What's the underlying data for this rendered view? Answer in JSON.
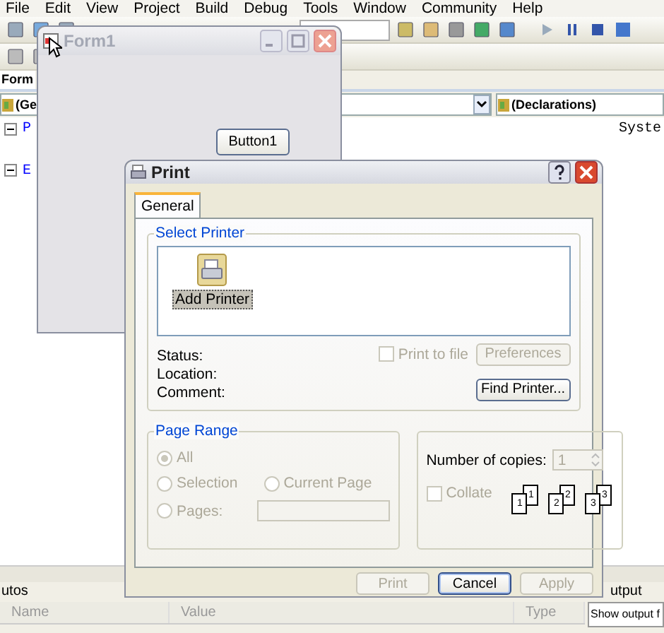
{
  "menu": [
    "File",
    "Edit",
    "View",
    "Project",
    "Build",
    "Debug",
    "Tools",
    "Window",
    "Community",
    "Help"
  ],
  "editor": {
    "tab": "Form",
    "left_dropdown": "(Ge",
    "right_dropdown": "(Declarations)",
    "code": [
      {
        "text": "P",
        "kind": "keyword"
      },
      {
        "text": "E",
        "kind": "keyword"
      },
      {
        "text": "Syste",
        "kind": "plain"
      }
    ]
  },
  "autos_panel": {
    "title": "utos",
    "columns": [
      "Name",
      "Value",
      "Type"
    ]
  },
  "output_panel": {
    "title": "utput",
    "dropdown": "Show output f"
  },
  "form_window": {
    "title": "Form1",
    "button": "Button1"
  },
  "print_dialog": {
    "title": "Print",
    "tabs": [
      {
        "label": "General",
        "selected": true
      }
    ],
    "select_printer": {
      "title": "Select Printer",
      "printers": [
        {
          "label": "Add Printer",
          "selected": true
        }
      ]
    },
    "info_labels": [
      "Status:",
      "Location:",
      "Comment:"
    ],
    "print_to_file": {
      "label": "Print to file",
      "checked": false,
      "disabled": true
    },
    "side_buttons": [
      {
        "label": "Preferences",
        "disabled": true
      },
      {
        "label": "Find Printer...",
        "disabled": false
      }
    ],
    "page_range": {
      "title": "Page Range",
      "options": [
        {
          "label": "All",
          "selected": true,
          "disabled": true,
          "kind": "radio"
        },
        {
          "label": "Selection",
          "selected": false,
          "disabled": true,
          "kind": "radio"
        },
        {
          "label": "Current Page",
          "selected": false,
          "disabled": true,
          "kind": "radio"
        },
        {
          "label": "Pages:",
          "selected": false,
          "disabled": true,
          "kind": "field"
        }
      ]
    },
    "copies": {
      "label": "Number of copies:",
      "value": "1",
      "disabled": true
    },
    "collate": {
      "label": "Collate",
      "checked": false,
      "disabled": true,
      "pages": [
        {
          "back": "1",
          "front": "1"
        },
        {
          "back": "2",
          "front": "2"
        },
        {
          "back": "3",
          "front": "3"
        }
      ]
    },
    "buttons": [
      {
        "label": "Print",
        "disabled": true,
        "default": false
      },
      {
        "label": "Cancel",
        "disabled": false,
        "default": true
      },
      {
        "label": "Apply",
        "disabled": true,
        "default": false
      }
    ]
  }
}
